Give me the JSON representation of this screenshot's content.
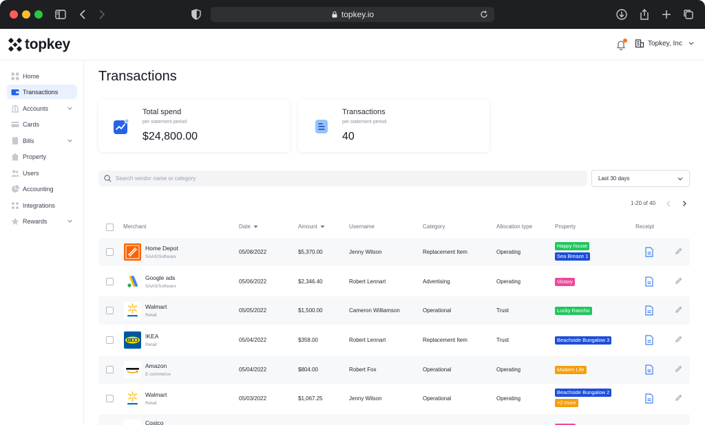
{
  "browser": {
    "url": "topkey.io"
  },
  "header": {
    "logo_text": "topkey",
    "company": "Topkey, Inc"
  },
  "sidebar": {
    "items": [
      {
        "label": "Home",
        "icon": "grid-icon",
        "active": false,
        "expandable": false
      },
      {
        "label": "Transactions",
        "icon": "wallet-icon",
        "active": true,
        "expandable": false
      },
      {
        "label": "Accounts",
        "icon": "bank-icon",
        "active": false,
        "expandable": true
      },
      {
        "label": "Cards",
        "icon": "card-icon",
        "active": false,
        "expandable": false
      },
      {
        "label": "Bills",
        "icon": "bill-icon",
        "active": false,
        "expandable": true
      },
      {
        "label": "Property",
        "icon": "house-icon",
        "active": false,
        "expandable": false
      },
      {
        "label": "Users",
        "icon": "users-icon",
        "active": false,
        "expandable": false
      },
      {
        "label": "Accounting",
        "icon": "pie-icon",
        "active": false,
        "expandable": false
      },
      {
        "label": "Integrations",
        "icon": "integrations-icon",
        "active": false,
        "expandable": false
      },
      {
        "label": "Rewards",
        "icon": "star-icon",
        "active": false,
        "expandable": true
      }
    ]
  },
  "main": {
    "title": "Transactions",
    "stats": [
      {
        "label": "Total spend",
        "sub": "per statement period",
        "value": "$24,800.00",
        "icon": "trend-chart-icon"
      },
      {
        "label": "Transactions",
        "sub": "per statement period",
        "value": "40",
        "icon": "document-icon"
      }
    ],
    "search": {
      "placeholder": "Search vendor name or category",
      "value": ""
    },
    "range": {
      "selected": "Last 30 days"
    },
    "pagination": {
      "label": "1-20 of 40"
    }
  },
  "table": {
    "columns": {
      "merchant": "Merchant",
      "date": "Date",
      "amount": "Amount",
      "username": "Username",
      "category": "Category",
      "allocation": "Allocation type",
      "property": "Property",
      "receipt": "Receipt"
    },
    "rows": [
      {
        "merchant": "Home Depot",
        "type": "SAAS/Software",
        "logo": "home-depot",
        "date": "05/08/2022",
        "amount": "$5,370.00",
        "username": "Jenny Wilson",
        "category": "Replacement Item",
        "allocation": "Operating",
        "tags": [
          {
            "text": "Happy house",
            "color": "#22c55e"
          },
          {
            "text": "Sea Breaze 1",
            "color": "#1d4ed8"
          }
        ]
      },
      {
        "merchant": "Google ads",
        "type": "SAAS/Software",
        "logo": "google-ads",
        "date": "05/06/2022",
        "amount": "$2,346.40",
        "username": "Robert Lennart",
        "category": "Advertising",
        "allocation": "Operating",
        "tags": [
          {
            "text": "Victory",
            "color": "#ec4899"
          }
        ]
      },
      {
        "merchant": "Walmart",
        "type": "Retail",
        "logo": "walmart",
        "date": "05/05/2022",
        "amount": "$1,500.00",
        "username": "Cameron Williamson",
        "category": "Operational",
        "allocation": "Trust",
        "tags": [
          {
            "text": "Lucky Rancho",
            "color": "#22c55e"
          }
        ]
      },
      {
        "merchant": "IKEA",
        "type": "Retail",
        "logo": "ikea",
        "date": "05/04/2022",
        "amount": "$358.00",
        "username": "Robert Lennart",
        "category": "Replacement Item",
        "allocation": "Trust",
        "tags": [
          {
            "text": "Beachside Bungalow 3",
            "color": "#1d4ed8"
          }
        ]
      },
      {
        "merchant": "Amazon",
        "type": "E-commerce",
        "logo": "amazon",
        "date": "05/04/2022",
        "amount": "$804.00",
        "username": "Robert Fox",
        "category": "Operational",
        "allocation": "Operating",
        "tags": [
          {
            "text": "Modern Life",
            "color": "#f59e0b"
          }
        ]
      },
      {
        "merchant": "Walmart",
        "type": "Retail",
        "logo": "walmart",
        "date": "05/03/2022",
        "amount": "$1,067.25",
        "username": "Jenny Wilson",
        "category": "Operational",
        "allocation": "Operating",
        "tags": [
          {
            "text": "Beachside Bungalow 2",
            "color": "#1d4ed8"
          },
          {
            "text": "+2 more",
            "color": "#f59e0b"
          }
        ]
      },
      {
        "merchant": "Costco",
        "type": "",
        "logo": "costco",
        "date": "",
        "amount": "",
        "username": "",
        "category": "",
        "allocation": "",
        "tags": [
          {
            "text": "",
            "color": "#ec4899"
          }
        ]
      }
    ]
  }
}
